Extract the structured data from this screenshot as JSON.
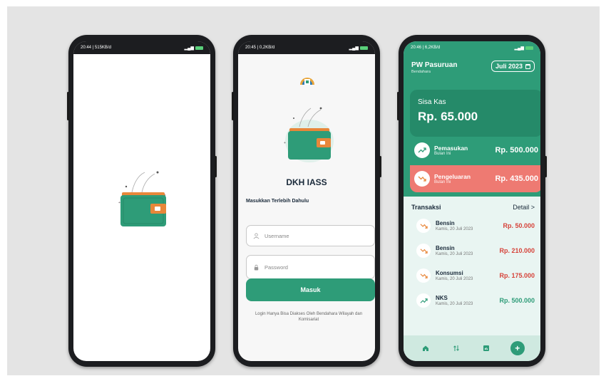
{
  "colors": {
    "primary": "#2e9c78",
    "primary_dark": "#258a69",
    "expense": "#ee7a72",
    "negative_text": "#d6433a"
  },
  "phone1": {
    "status": {
      "time": "20:44 | 515KB/d",
      "battery": "battery-icon"
    },
    "illustration": "wallet-illustration"
  },
  "phone2": {
    "status": {
      "time": "20:45 | 0,2KB/d",
      "battery": "battery-icon"
    },
    "brand": "DKH IASS",
    "prompt": "Masukkan Terlebih Dahulu",
    "username_placeholder": "Username",
    "password_placeholder": "Password",
    "login_button": "Masuk",
    "note": "Login Hanya Bisa Diakses Oleh Bendahara Wilayah dan Komisariat"
  },
  "phone3": {
    "status": {
      "time": "20:46 | 6,2KB/d",
      "battery": "battery-icon"
    },
    "org_name": "PW Pasuruan",
    "org_role": "Bendahara",
    "month": "Juli 2023",
    "balance_label": "Sisa Kas",
    "balance_value": "Rp. 65.000",
    "income": {
      "title": "Pemasukan",
      "subtitle": "Bulan Ini",
      "amount": "Rp. 500.000"
    },
    "expense": {
      "title": "Pengeluaran",
      "subtitle": "Bulan Ini",
      "amount": "Rp. 435.000"
    },
    "transactions_title": "Transaksi",
    "detail_link": "Detail >",
    "transactions": [
      {
        "name": "Bensin",
        "date": "Kamis, 20 Juli 2023",
        "amount": "Rp. 50.000",
        "type": "expense"
      },
      {
        "name": "Bensin",
        "date": "Kamis, 20 Juli 2023",
        "amount": "Rp. 210.000",
        "type": "expense"
      },
      {
        "name": "Konsumsi",
        "date": "Kamis, 20 Juli 2023",
        "amount": "Rp. 175.000",
        "type": "expense"
      },
      {
        "name": "NKS",
        "date": "Kamis, 20 Juli 2023",
        "amount": "Rp. 500.000",
        "type": "income"
      }
    ],
    "nav": [
      "home-icon",
      "transfer-icon",
      "report-icon",
      "add-icon"
    ],
    "fab_label": "+"
  }
}
